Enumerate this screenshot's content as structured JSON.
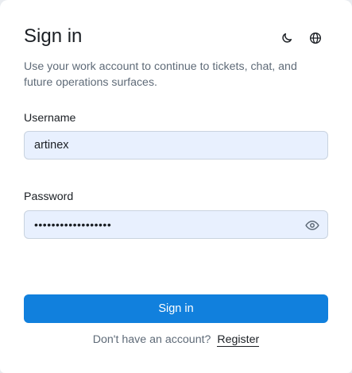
{
  "header": {
    "title": "Sign in",
    "subtitle": "Use your work account to continue to tickets, chat, and future operations surfaces."
  },
  "icons": {
    "theme": "moon-icon",
    "language": "globe-icon",
    "password_toggle": "eye-icon"
  },
  "form": {
    "username": {
      "label": "Username",
      "value": "artinex"
    },
    "password": {
      "label": "Password",
      "value": "••••••••••••••••••"
    },
    "submit_label": "Sign in"
  },
  "footer": {
    "prompt": "Don't have an account?",
    "register_label": "Register"
  },
  "colors": {
    "primary": "#1180dd",
    "field_background": "#e8f0fe",
    "muted_text": "#5f6b78"
  }
}
